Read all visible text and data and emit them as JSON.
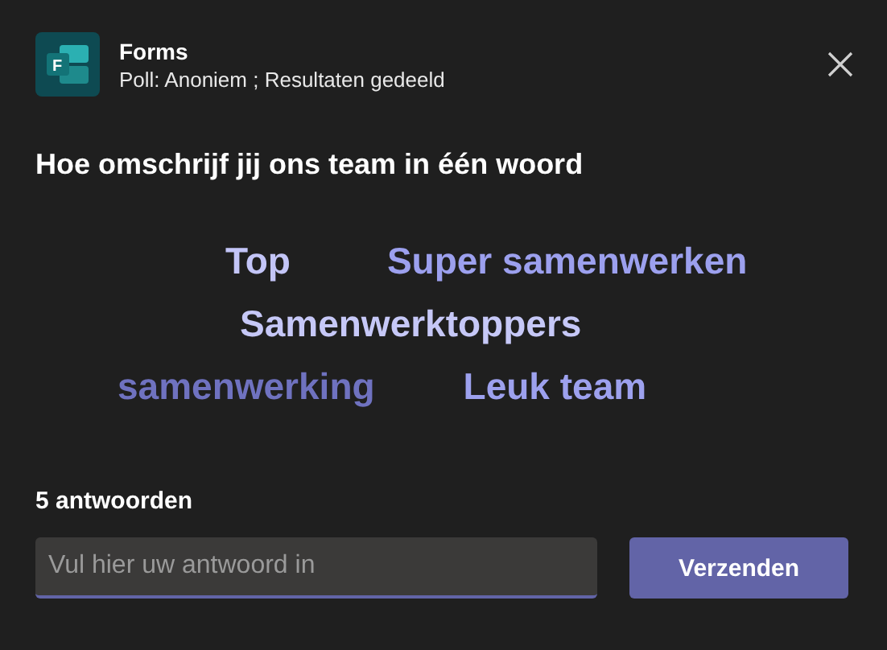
{
  "header": {
    "app_name": "Forms",
    "subtitle": "Poll: Anoniem ; Resultaten gedeeld",
    "app_icon_letter": "F"
  },
  "question": "Hoe omschrijf jij ons team in één woord",
  "word_cloud": [
    [
      {
        "text": "Top",
        "color": "#c3c5f7"
      },
      {
        "text": "Super samenwerken",
        "color": "#9ca0ee"
      }
    ],
    [
      {
        "text": "Samenwerktoppers",
        "color": "#c6c8f7"
      }
    ],
    [
      {
        "text": "samenwerking",
        "color": "#6f72c0"
      },
      {
        "text": "Leuk team",
        "color": "#9da1ee"
      }
    ]
  ],
  "response_count": "5 antwoorden",
  "answer": {
    "placeholder": "Vul hier uw antwoord in"
  },
  "submit_label": "Verzenden"
}
